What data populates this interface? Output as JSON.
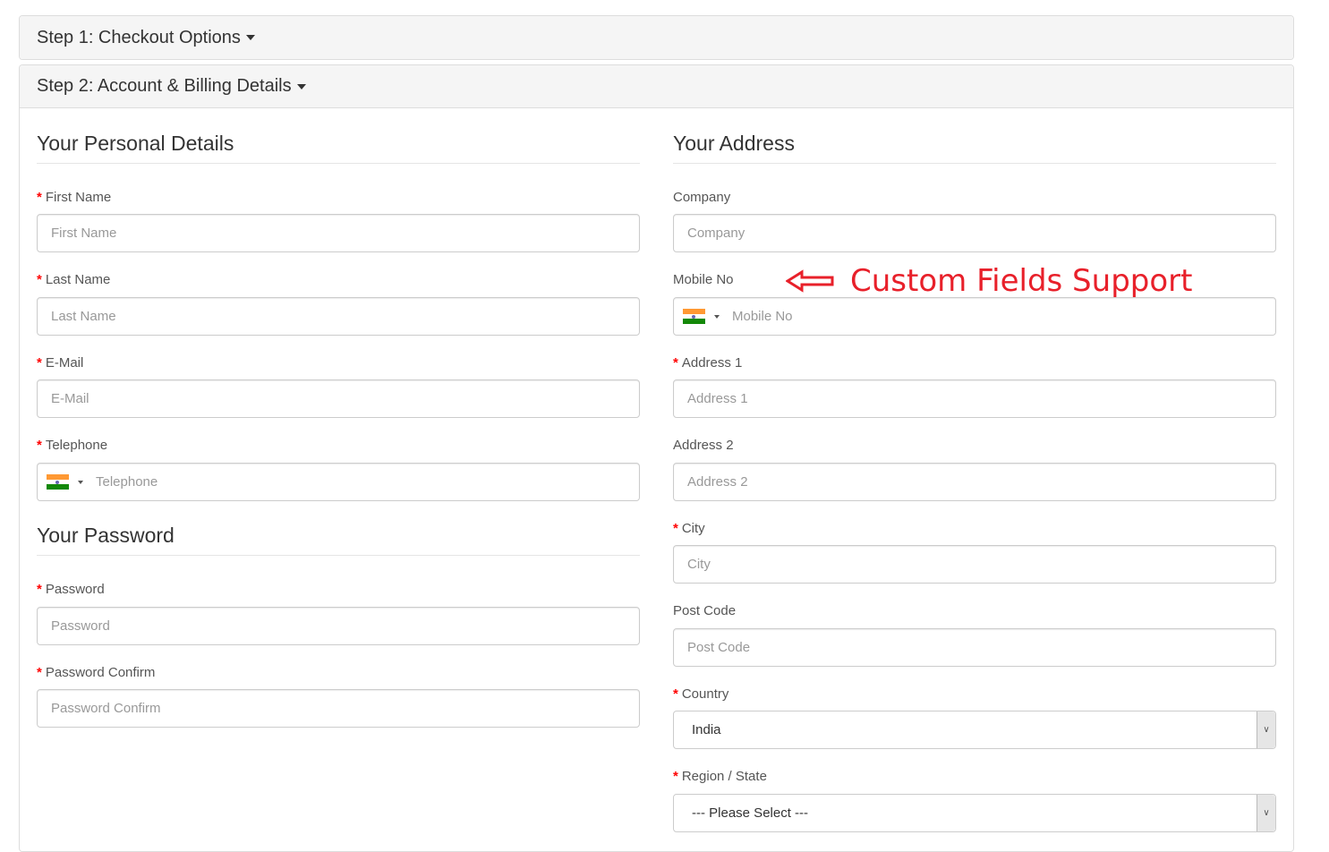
{
  "steps": [
    {
      "label": "Step 1: Checkout Options"
    },
    {
      "label": "Step 2: Account & Billing Details"
    }
  ],
  "personal": {
    "heading": "Your Personal Details",
    "fields": [
      {
        "label": "First Name",
        "placeholder": "First Name",
        "required": true
      },
      {
        "label": "Last Name",
        "placeholder": "Last Name",
        "required": true
      },
      {
        "label": "E-Mail",
        "placeholder": "E-Mail",
        "required": true
      },
      {
        "label": "Telephone",
        "placeholder": "Telephone",
        "required": true,
        "flag": "india-flag-icon"
      }
    ]
  },
  "password": {
    "heading": "Your Password",
    "fields": [
      {
        "label": "Password",
        "placeholder": "Password",
        "required": true
      },
      {
        "label": "Password Confirm",
        "placeholder": "Password Confirm",
        "required": true
      }
    ]
  },
  "address": {
    "heading": "Your Address",
    "fields": [
      {
        "label": "Company",
        "placeholder": "Company",
        "required": false
      },
      {
        "label": "Mobile No",
        "placeholder": "Mobile No",
        "required": false,
        "flag": "india-flag-icon"
      },
      {
        "label": "Address 1",
        "placeholder": "Address 1",
        "required": true
      },
      {
        "label": "Address 2",
        "placeholder": "Address 2",
        "required": false
      },
      {
        "label": "City",
        "placeholder": "City",
        "required": true
      },
      {
        "label": "Post Code",
        "placeholder": "Post Code",
        "required": false
      },
      {
        "label": "Country",
        "value": "India",
        "required": true,
        "type": "select"
      },
      {
        "label": "Region / State",
        "value": "--- Please Select ---",
        "required": true,
        "type": "select"
      }
    ]
  },
  "annotation": {
    "text": "Custom Fields Support",
    "color": "#e8202a",
    "icon": "left-arrow-icon"
  },
  "required_marker": "*",
  "colors": {
    "required": "#ff0000",
    "panel_heading_bg": "#f5f5f5",
    "border": "#cccccc"
  }
}
